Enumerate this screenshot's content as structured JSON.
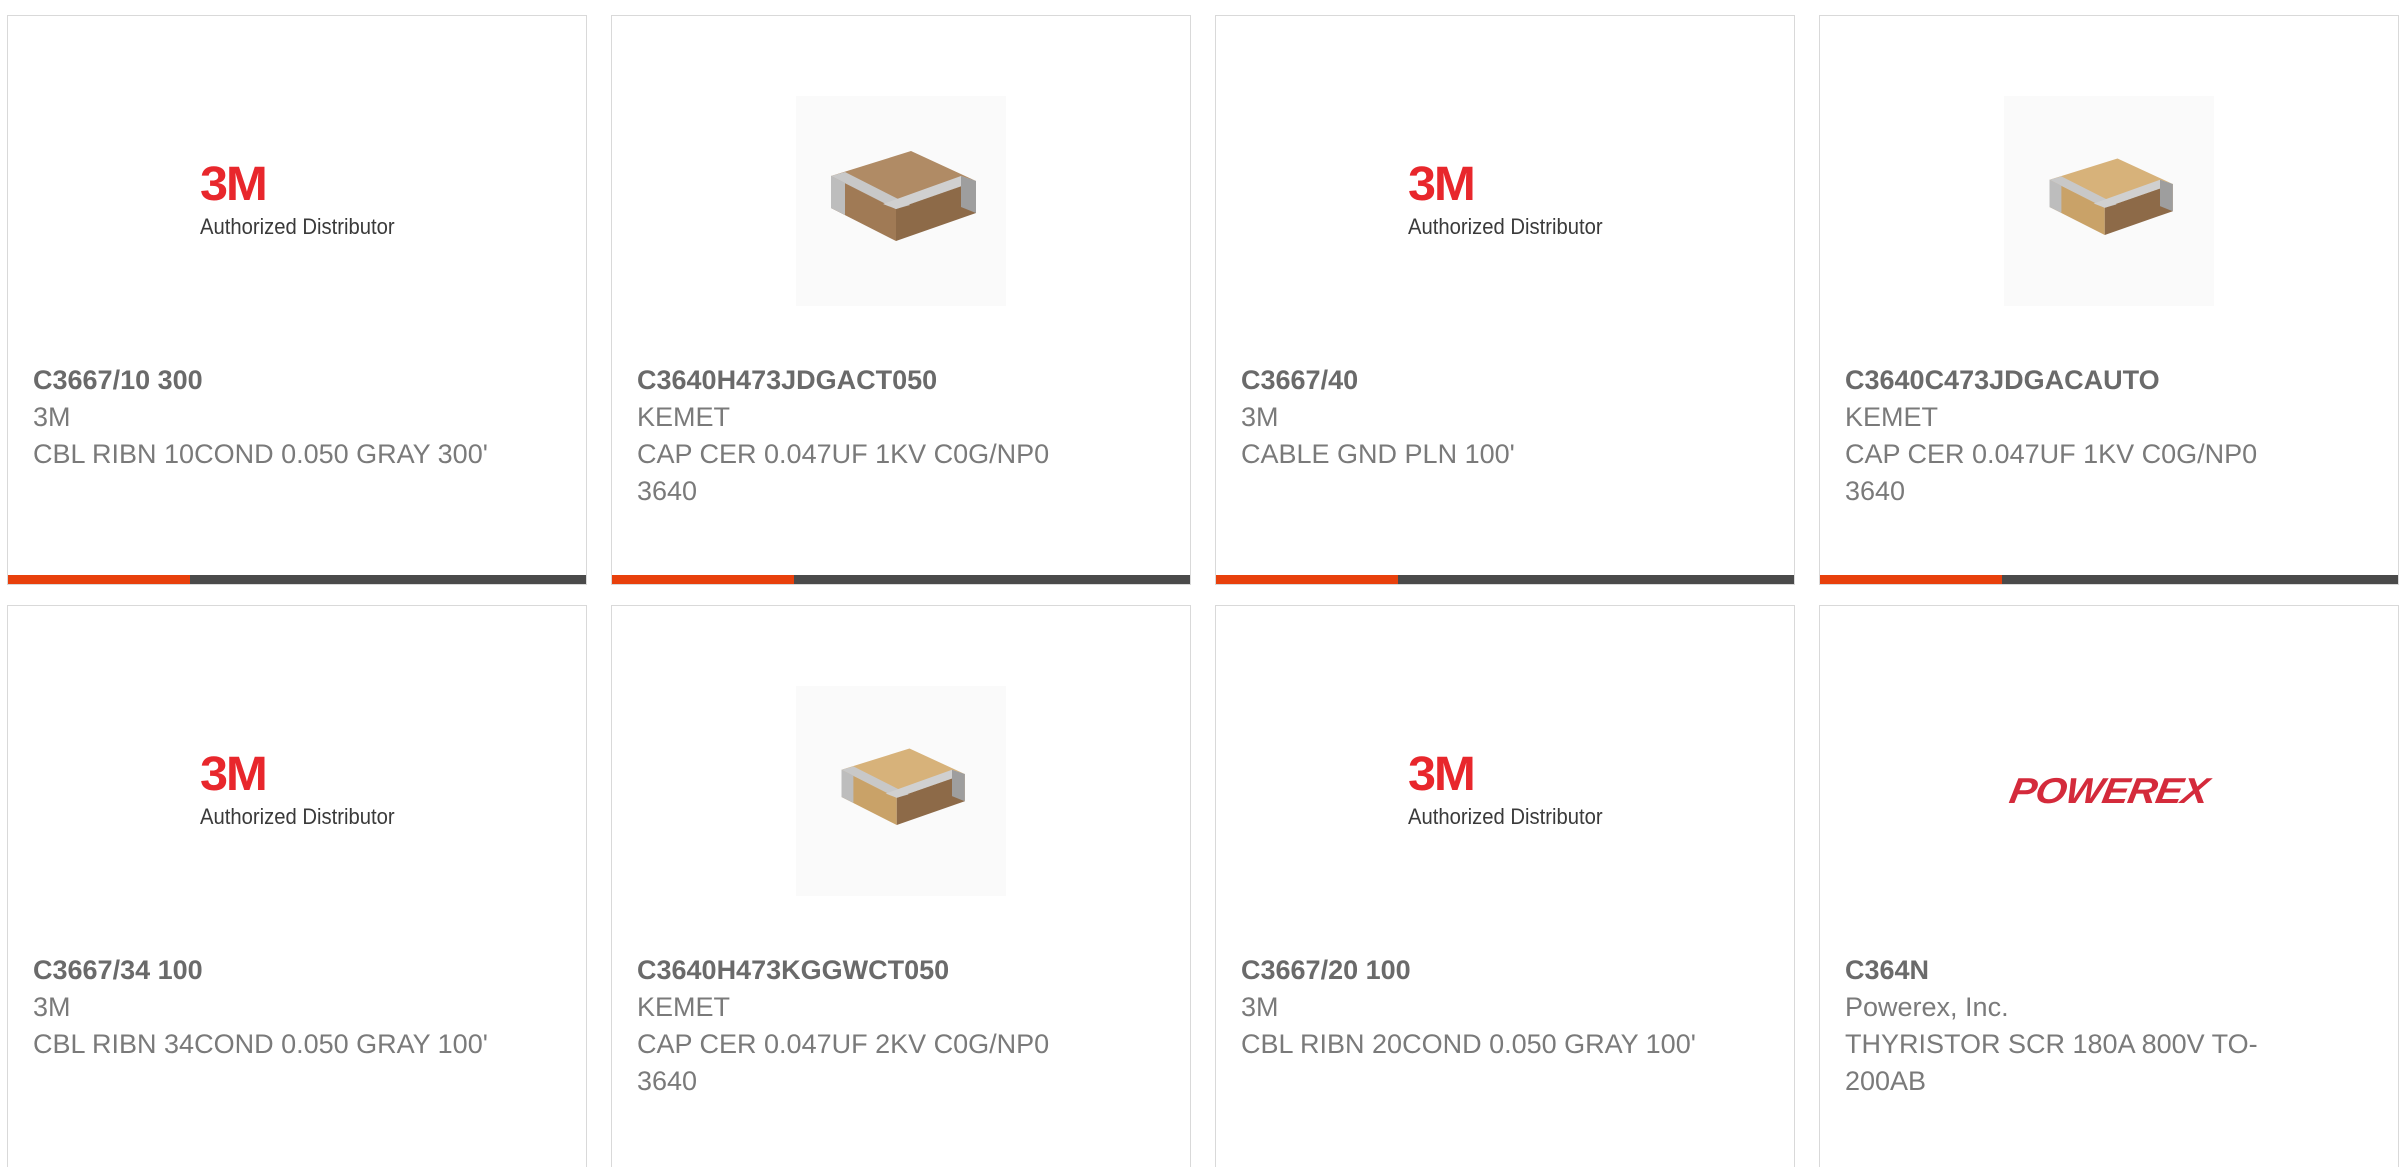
{
  "colors": {
    "accent": "#e8400c",
    "bar": "#4a4a4a",
    "border": "#d9d9d9",
    "text": "#7a7a7a",
    "logo_3m": "#e8272c",
    "logo_powerex": "#d42a3b"
  },
  "products": [
    {
      "part_number": "C3667/10 300",
      "manufacturer": "3M",
      "description": "CBL RIBN 10COND 0.050 GRAY 300'",
      "image": "3m-logo",
      "logo_mark": "3M",
      "logo_tag": "Authorized Distributor"
    },
    {
      "part_number": "C3640H473JDGACT050",
      "manufacturer": "KEMET",
      "description": "CAP CER 0.047UF 1KV C0G/NP0 3640",
      "image": "capacitor-brown"
    },
    {
      "part_number": "C3667/40",
      "manufacturer": "3M",
      "description": "CABLE GND PLN 100'",
      "image": "3m-logo",
      "logo_mark": "3M",
      "logo_tag": "Authorized Distributor"
    },
    {
      "part_number": "C3640C473JDGACAUTO",
      "manufacturer": "KEMET",
      "description": "CAP CER 0.047UF 1KV C0G/NP0 3640",
      "image": "capacitor-tan"
    },
    {
      "part_number": "C3667/34 100",
      "manufacturer": "3M",
      "description": "CBL RIBN 34COND 0.050 GRAY 100'",
      "image": "3m-logo",
      "logo_mark": "3M",
      "logo_tag": "Authorized Distributor"
    },
    {
      "part_number": "C3640H473KGGWCT050",
      "manufacturer": "KEMET",
      "description": "CAP CER 0.047UF 2KV C0G/NP0 3640",
      "image": "capacitor-tan"
    },
    {
      "part_number": "C3667/20 100",
      "manufacturer": "3M",
      "description": "CBL RIBN 20COND 0.050 GRAY 100'",
      "image": "3m-logo",
      "logo_mark": "3M",
      "logo_tag": "Authorized Distributor"
    },
    {
      "part_number": "C364N",
      "manufacturer": "Powerex, Inc.",
      "description": "THYRISTOR SCR 180A 800V TO-200AB",
      "image": "powerex-logo",
      "logo_mark": "POWEREX"
    }
  ]
}
